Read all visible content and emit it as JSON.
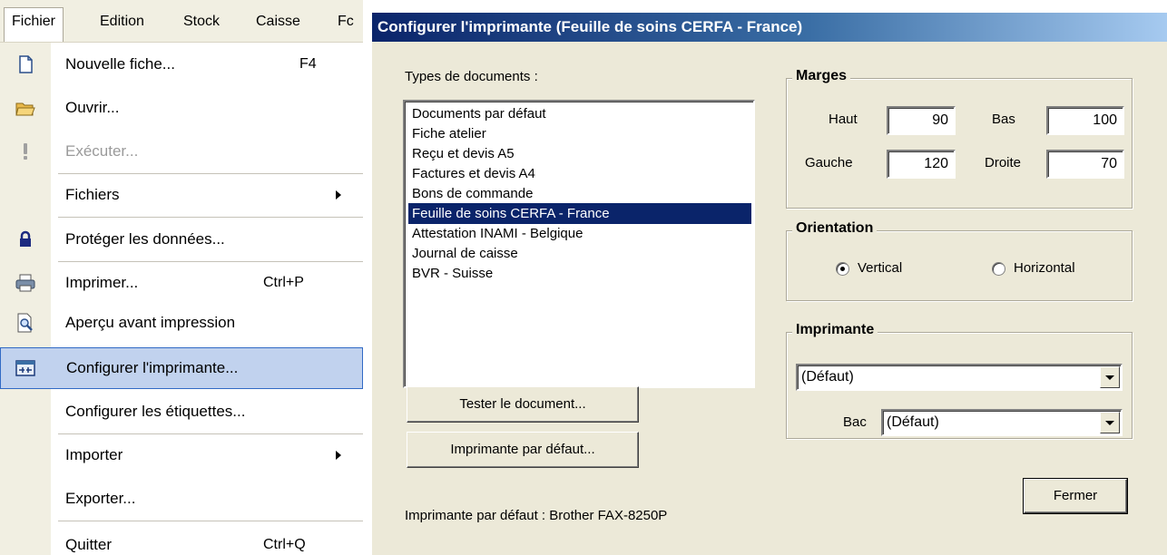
{
  "menubar": {
    "items": [
      "Fichier",
      "Edition",
      "Stock",
      "Caisse",
      "Fc"
    ]
  },
  "menu": {
    "items": [
      {
        "label": "Nouvelle fiche...",
        "shortcut": "F4",
        "icon": "new-document-icon"
      },
      {
        "label": "Ouvrir...",
        "icon": "open-folder-icon"
      },
      {
        "label": "Exécuter...",
        "icon": "exclamation-icon",
        "disabled": true
      },
      {
        "label": "Fichiers",
        "submenu": true
      },
      {
        "label": "Protéger les données...",
        "icon": "lock-icon"
      },
      {
        "label": "Imprimer...",
        "shortcut": "Ctrl+P",
        "icon": "printer-icon"
      },
      {
        "label": "Aperçu avant impression",
        "icon": "print-preview-icon"
      },
      {
        "label": "Configurer l'imprimante...",
        "icon": "printer-setup-icon",
        "highlighted": true
      },
      {
        "label": "Configurer les étiquettes..."
      },
      {
        "label": "Importer",
        "submenu": true
      },
      {
        "label": "Exporter..."
      },
      {
        "label": "Quitter",
        "shortcut": "Ctrl+Q"
      }
    ]
  },
  "dialog": {
    "title": "Configurer l'imprimante (Feuille de soins CERFA - France)",
    "types_label": "Types de documents :",
    "documents": [
      "Documents par défaut",
      "Fiche atelier",
      "Reçu et devis A5",
      "Factures et devis A4",
      "Bons de commande",
      "Feuille de soins CERFA - France",
      "Attestation INAMI - Belgique",
      "Journal de caisse",
      "BVR - Suisse"
    ],
    "selected_document": "Feuille de soins CERFA - France",
    "test_button": "Tester le document...",
    "default_printer_button": "Imprimante par défaut...",
    "default_printer_status": "Imprimante par défaut : Brother FAX-8250P",
    "margins": {
      "title": "Marges",
      "haut_label": "Haut",
      "haut": "90",
      "bas_label": "Bas",
      "bas": "100",
      "gauche_label": "Gauche",
      "gauche": "120",
      "droite_label": "Droite",
      "droite": "70"
    },
    "orientation": {
      "title": "Orientation",
      "vertical": "Vertical",
      "horizontal": "Horizontal",
      "selected": "Vertical"
    },
    "printer": {
      "title": "Imprimante",
      "value": "(Défaut)",
      "bac_label": "Bac",
      "bac_value": "(Défaut)"
    },
    "close_button": "Fermer"
  }
}
